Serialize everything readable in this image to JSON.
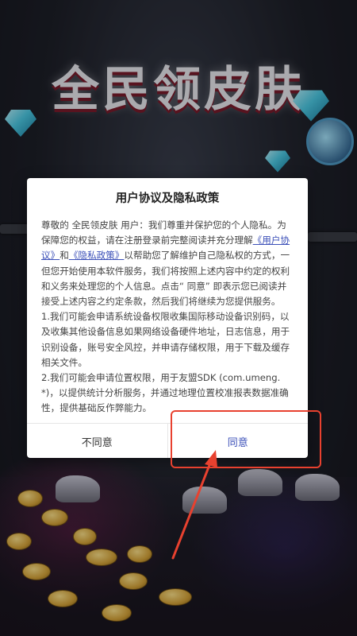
{
  "background": {
    "banner_title": "全民领皮肤"
  },
  "dialog": {
    "title": "用户协议及隐私政策",
    "intro_prefix": "尊敬的 全民领皮肤 用户：我们尊重并保护您的个人隐私。为保障您的权益，请在注册登录前完整阅读并充分理解",
    "link_user_agreement": "《用户协议》",
    "and_text": "和",
    "link_privacy_policy": "《隐私政策》",
    "intro_suffix": "以帮助您了解维护自己隐私权的方式，一但您开始使用本软件服务，我们将按照上述内容中约定的权利和义务来处理您的个人信息。点击“ 同意” 即表示您已阅读并接受上述内容之约定条款，然后我们将继续为您提供服务。",
    "item_1": "1.我们可能会申请系统设备权限收集国际移动设备识别码，以及收集其他设备信息如果网络设备硬件地址，日志信息，用于识别设备，账号安全风控，并申请存储权限，用于下载及缓存相关文件。",
    "item_2": "2.我们可能会申请位置权限，用于友盟SDK (com.umeng.*)，以提供统计分析服务，并通过地理位置校准报表数据准确性，提供基础反作弊能力。",
    "disagree_label": "不同意",
    "agree_label": "同意"
  },
  "colors": {
    "link": "#3b4fb8",
    "annotation": "#e8412f"
  }
}
